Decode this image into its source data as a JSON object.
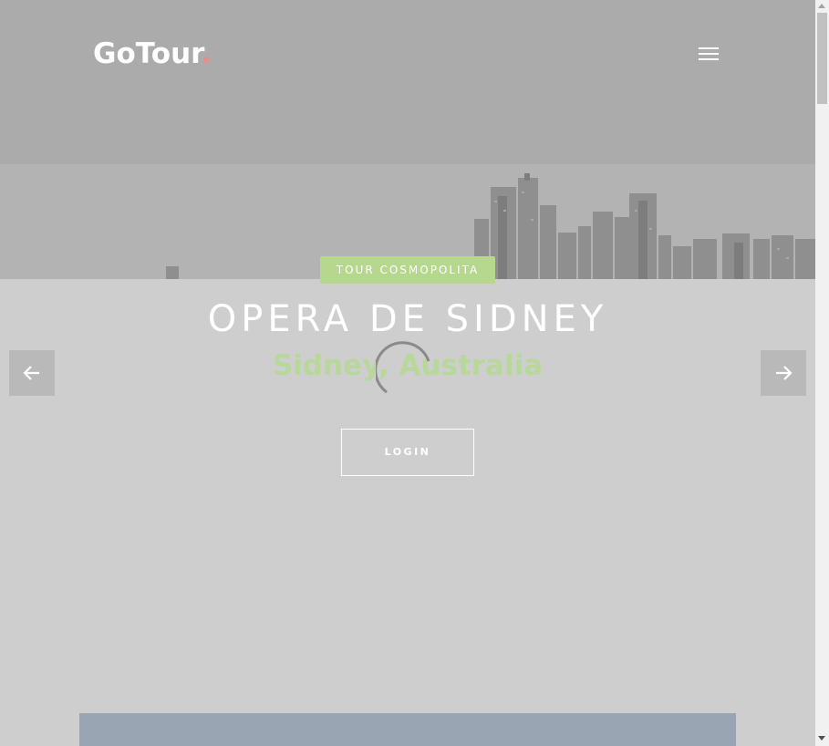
{
  "header": {
    "logo_text": "GoTour",
    "logo_dot": ".",
    "menu_icon": "hamburger-menu-icon"
  },
  "slide": {
    "badge": "TOUR COSMOPOLITA",
    "title": "OPERA DE SIDNEY",
    "subtitle": "Sidney, Australia",
    "cta_label": "LOGIN"
  },
  "carousel": {
    "prev_icon": "arrow-left-icon",
    "next_icon": "arrow-right-icon",
    "loading_icon": "spinner-icon"
  },
  "colors": {
    "overlay": "#cecece",
    "accent_green": "#b5d88e",
    "subtitle_green": "#b8d89b",
    "logo_dot": "#f08a8a",
    "panel": "#9aa5b4"
  }
}
